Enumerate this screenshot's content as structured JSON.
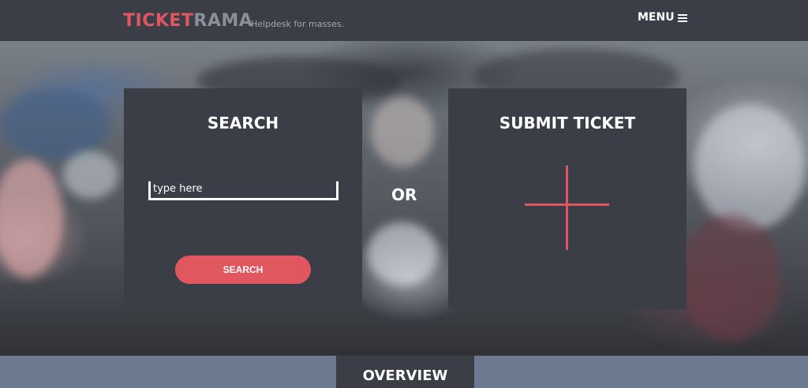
{
  "header": {
    "logo_part1": "TICKET",
    "logo_part2": "RAMA",
    "tagline": "Helpdesk for masses.",
    "menu_label": "MENU",
    "menu_icon": "hamburger-icon"
  },
  "search_panel": {
    "title": "SEARCH",
    "input_placeholder": "type here",
    "input_value": "",
    "button_label": "SEARCH"
  },
  "separator": {
    "label": "OR"
  },
  "submit_panel": {
    "title": "SUBMIT TICKET",
    "icon": "plus-icon"
  },
  "footer": {
    "tab_label": "OVERVIEW"
  },
  "colors": {
    "accent": "#e0575f",
    "panel_bg": "#3b3e47",
    "footer_bar": "#6b7a8f",
    "logo_secondary": "#8a8f99"
  }
}
